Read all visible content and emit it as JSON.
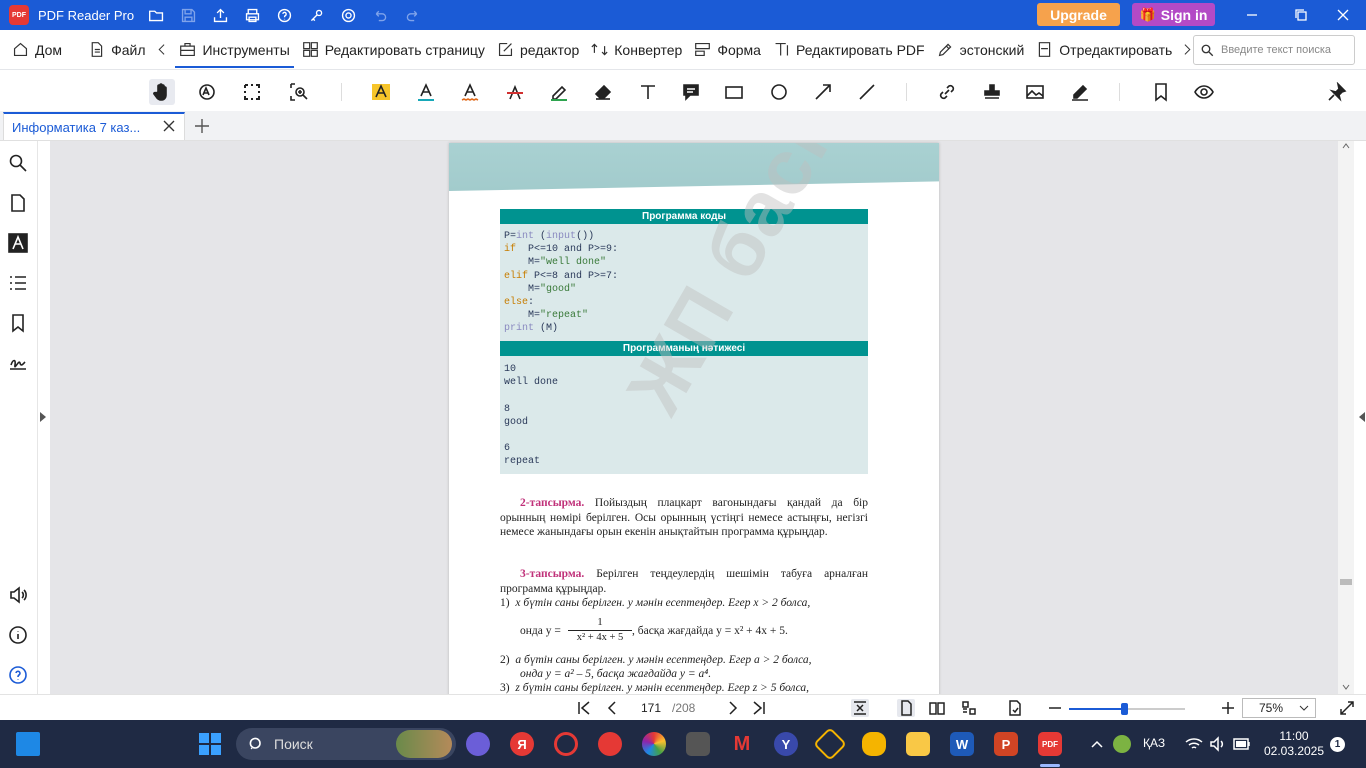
{
  "app": {
    "name": "PDF Reader Pro",
    "logo_text": "PDF",
    "upgrade_label": "Upgrade",
    "signin_label": "Sign in"
  },
  "menu": {
    "home": "Дом",
    "file": "Файл",
    "tools": "Инструменты",
    "edit_page": "Редактировать страницу",
    "editor": "редактор",
    "converter": "Конвертер",
    "form": "Форма",
    "edit_pdf": "Редактировать PDF",
    "estonian": "эстонский",
    "redact": "Отредактировать"
  },
  "search": {
    "placeholder": "Введите текст поиска"
  },
  "tab": {
    "title": "Информатика 7 каз..."
  },
  "page": {
    "code_header": "Программа коды",
    "code_lines": [
      {
        "parts": [
          {
            "t": "P=",
            "c": ""
          },
          {
            "t": "int",
            "c": "bi"
          },
          {
            "t": " (",
            "c": ""
          },
          {
            "t": "input",
            "c": "bi"
          },
          {
            "t": "())",
            "c": ""
          }
        ]
      },
      {
        "parts": [
          {
            "t": "if",
            "c": "kw"
          },
          {
            "t": "  P<=10 and P>=9:",
            "c": ""
          }
        ]
      },
      {
        "parts": [
          {
            "t": "    M=",
            "c": ""
          },
          {
            "t": "\"well done\"",
            "c": "str"
          }
        ]
      },
      {
        "parts": [
          {
            "t": "elif",
            "c": "kw"
          },
          {
            "t": " P<=8 and P>=7:",
            "c": ""
          }
        ]
      },
      {
        "parts": [
          {
            "t": "    M=",
            "c": ""
          },
          {
            "t": "\"good\"",
            "c": "str"
          }
        ]
      },
      {
        "parts": [
          {
            "t": "else",
            "c": "kw"
          },
          {
            "t": ":",
            "c": ""
          }
        ]
      },
      {
        "parts": [
          {
            "t": "    M=",
            "c": ""
          },
          {
            "t": "\"repeat\"",
            "c": "str"
          }
        ]
      },
      {
        "parts": [
          {
            "t": "print",
            "c": "bi"
          },
          {
            "t": " (M)",
            "c": ""
          }
        ]
      }
    ],
    "result_header": "Программаның нәтижесі",
    "result_text": "10\nwell done\n\n8\ngood\n\n6\nrepeat",
    "task2_label": "2-тапсырма.",
    "task2_text": " Пойыздың плацкарт вагонындағы қандай да бір орынның нөмірі берілген. Осы орынның үстіңгі немесе астыңғы, негізгі немесе жанындағы орын екенін анықтайтын программа құрыңдар.",
    "task3_label": "3-тапсырма.",
    "task3_text": " Берілген теңдеулердің шешімін табуға арналған программа құрыңдар.",
    "item1_num": "1)",
    "item1_text": "x бүтін саны берілген. y мәнін есептеңдер. Егер x > 2 болса,",
    "item1_formula_pre": "онда y =",
    "item1_numerator": "1",
    "item1_denominator": "x² + 4x + 5",
    "item1_formula_post": ", басқа жағдайда y = x² + 4x + 5.",
    "item2_num": "2)",
    "item2_text": "a бүтін саны берілген. y мәнін есептеңдер. Егер a > 2 болса,",
    "item2_text2": "онда y = a² – 5, басқа жағдайда y = a⁴.",
    "item3_num": "3)",
    "item3_text": "z бүтін саны берілген. y мәнін есептеңдер. Егер z > 5 болса,",
    "watermark": "ЖП баспасы"
  },
  "status": {
    "page_current": "171",
    "page_total": "/208",
    "zoom": "75%",
    "zoom_level": 0.47
  },
  "taskbar": {
    "search_label": "Поиск",
    "lang": "ҚАЗ",
    "time": "11:00",
    "date": "02.03.2025",
    "notif_count": "1"
  },
  "colors": {
    "titlebar": "#1b5bd6",
    "upgrade": "#f6a24c",
    "signin": "#b34ac6",
    "code_header": "#009390",
    "task_label": "#c03079"
  }
}
